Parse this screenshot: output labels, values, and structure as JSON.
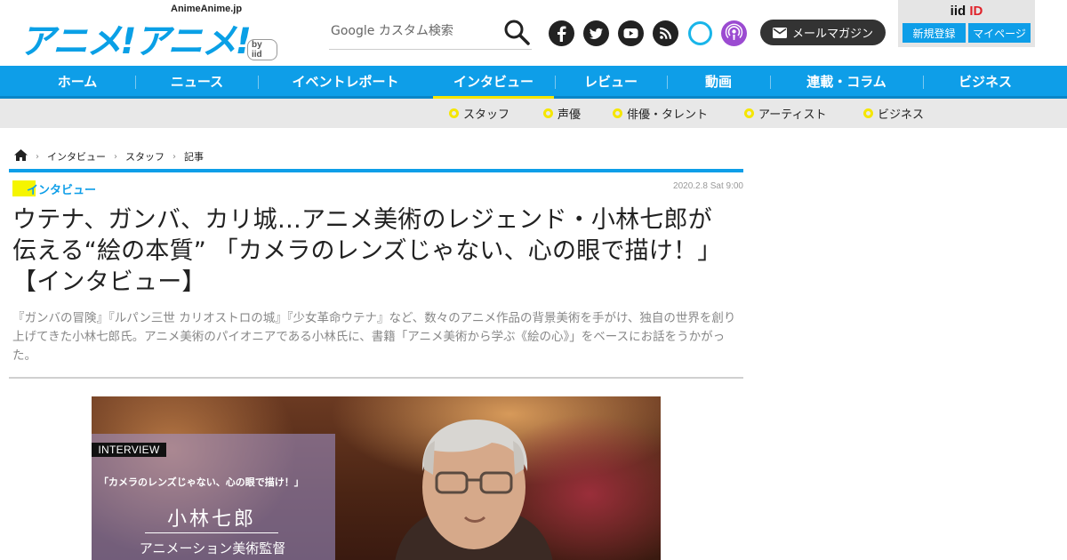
{
  "header": {
    "logo_domain": "AnimeAnime.jp",
    "logo_text": "アニメ!アニメ!",
    "logo_by": "by iid",
    "search": {
      "placeholder": "Google カスタム検索",
      "button_icon": "search-icon"
    },
    "social": [
      {
        "name": "facebook-icon",
        "color": "#222222"
      },
      {
        "name": "twitter-icon",
        "color": "#222222"
      },
      {
        "name": "youtube-icon",
        "color": "#222222"
      },
      {
        "name": "rss-icon",
        "color": "#222222"
      },
      {
        "name": "alexa-icon",
        "color": "#19b5e9"
      },
      {
        "name": "podcast-icon",
        "color": "#9b4bd1"
      }
    ],
    "magazine_label": "メールマガジン",
    "iid": {
      "title_prefix": "iid",
      "title_suffix": "ID",
      "register_label": "新規登録",
      "mypage_label": "マイページ"
    }
  },
  "nav": {
    "items": [
      {
        "label": "ホーム"
      },
      {
        "label": "ニュース"
      },
      {
        "label": "イベントレポート"
      },
      {
        "label": "インタビュー",
        "active": true
      },
      {
        "label": "レビュー"
      },
      {
        "label": "動画"
      },
      {
        "label": "連載・コラム"
      },
      {
        "label": "ビジネス"
      }
    ],
    "sub_items": [
      {
        "label": "スタッフ"
      },
      {
        "label": "声優"
      },
      {
        "label": "俳優・タレント"
      },
      {
        "label": "アーティスト"
      },
      {
        "label": "ビジネス"
      }
    ]
  },
  "breadcrumb": {
    "home_icon": "home-icon",
    "items": [
      "インタビュー",
      "スタッフ",
      "記事"
    ]
  },
  "article": {
    "category": "インタビュー",
    "date": "2020.2.8 Sat 9:00",
    "title": "ウテナ、ガンバ、カリ城…アニメ美術のレジェンド・小林七郎が伝える“絵の本質” 「カメラのレンズじゃない、心の眼で描け！」【インタビュー】",
    "lead": "『ガンバの冒険』『ルパン三世 カリオストロの城』『少女革命ウテナ』など、数々のアニメ作品の背景美術を手がけ、独自の世界を創り上げてきた小林七郎氏。アニメ美術のパイオニアである小林氏に、書籍「アニメ美術から学ぶ《絵の心》」をベースにお話をうかがった。"
  },
  "hero": {
    "badge": "INTERVIEW",
    "quote": "「カメラのレンズじゃない、心の眼で描け！」",
    "name": "小林七郎",
    "role": "アニメーション美術監督"
  },
  "colors": {
    "brand_blue": "#0e9ee8",
    "accent_yellow": "#f5e600",
    "dark": "#333333"
  }
}
